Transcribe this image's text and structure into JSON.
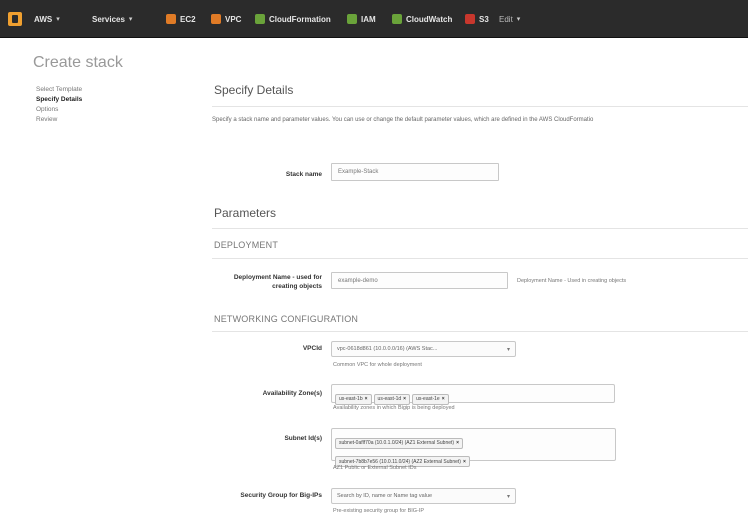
{
  "nav": {
    "aws": "AWS",
    "services": "Services",
    "items": [
      {
        "label": "EC2",
        "color": "#e07b26"
      },
      {
        "label": "VPC",
        "color": "#e07b26"
      },
      {
        "label": "CloudFormation",
        "color": "#6aa33a"
      },
      {
        "label": "IAM",
        "color": "#6aa33a"
      },
      {
        "label": "CloudWatch",
        "color": "#6aa33a"
      },
      {
        "label": "S3",
        "color": "#c8372d"
      }
    ],
    "edit": "Edit"
  },
  "page_title": "Create stack",
  "steps": [
    "Select Template",
    "Specify Details",
    "Options",
    "Review"
  ],
  "active_step": "Specify Details",
  "specify": {
    "heading": "Specify Details",
    "description": "Specify a stack name and parameter values. You can use or change the default parameter values, which are defined in the AWS CloudFormatio",
    "stack_name_label": "Stack name",
    "stack_name_value": "Example-Stack"
  },
  "parameters": {
    "heading": "Parameters",
    "deployment_heading": "DEPLOYMENT",
    "deployment_label": "Deployment Name - used for creating objects",
    "deployment_value": "example-demo",
    "deployment_hint": "Deployment Name - Used in creating objects",
    "networking_heading": "NETWORKING CONFIGURATION",
    "vpc_label": "VPCId",
    "vpc_value": "vpc-0618d861 (10.0.0.0/16) (AWS Stac...",
    "vpc_hint": "Common VPC for whole deployment",
    "az_label": "Availability Zone(s)",
    "az_tokens": [
      "us-east-1b",
      "us-east-1d",
      "us-east-1e"
    ],
    "az_hint": "Availability zones in which Bigip is being deployed",
    "subnet_label": "Subnet Id(s)",
    "subnet_tokens": [
      "subnet-0aflf70a (10.0.1.0/24) (AZ1 External Subnet)",
      "subnet-7b8b7e56 (10.0.11.0/24) (AZ2 External Subnet)"
    ],
    "subnet_hint": "AZ1 Public or External Subnet IDs",
    "sg_label": "Security Group for Big-IPs",
    "sg_placeholder": "Search by ID, name or Name tag value",
    "sg_hint": "Pre-existing security group for BIG-IP"
  }
}
